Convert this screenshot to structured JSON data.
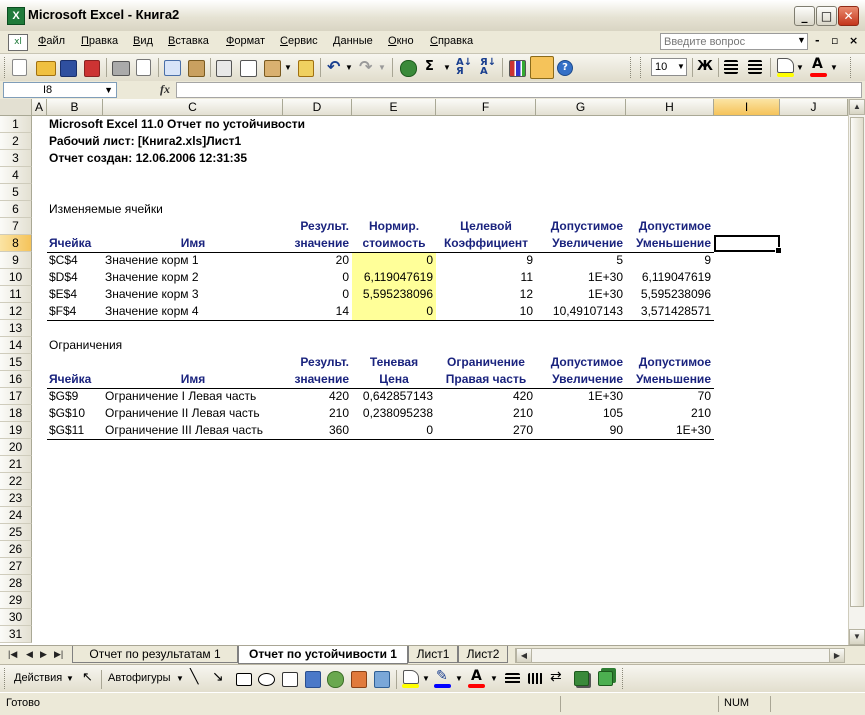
{
  "window": {
    "title": "Microsoft Excel - Книга2",
    "app_icon": "X",
    "controls": [
      "_",
      "□",
      "✕"
    ],
    "doc_icon": "xl",
    "mdi_controls": [
      "-",
      "▫",
      "×"
    ]
  },
  "menu": {
    "items": [
      {
        "label": "Файл",
        "u": "Ф",
        "rest": "айл"
      },
      {
        "label": "Правка",
        "u": "П",
        "rest": "равка"
      },
      {
        "label": "Вид",
        "u": "В",
        "rest": "ид"
      },
      {
        "label": "Вставка",
        "u": "В",
        "rest": "ставка"
      },
      {
        "label": "Формат",
        "u": "Ф",
        "rest": "ормат"
      },
      {
        "label": "Сервис",
        "u": "С",
        "rest": "ервис"
      },
      {
        "label": "Данные",
        "u": "Д",
        "rest": "анные"
      },
      {
        "label": "Окно",
        "u": "О",
        "rest": "кно"
      },
      {
        "label": "Справка",
        "u": "С",
        "rest": "правка"
      }
    ],
    "ask_placeholder": "Введите вопрос"
  },
  "toolbar": {
    "font_size": "10",
    "bold_label": "Ж",
    "sum_label": "Σ",
    "colors": {
      "fill": "#ffff00",
      "font": "#ff0000"
    }
  },
  "formula_bar": {
    "name_box": "I8",
    "fx_label": "fx",
    "value": ""
  },
  "columns": [
    "A",
    "B",
    "C",
    "D",
    "E",
    "F",
    "G",
    "H",
    "I",
    "J"
  ],
  "selected_column": "I",
  "rows": [
    "1",
    "2",
    "3",
    "4",
    "5",
    "6",
    "7",
    "8",
    "9",
    "10",
    "11",
    "12",
    "13",
    "14",
    "15",
    "16",
    "17",
    "18",
    "19",
    "20",
    "21",
    "22",
    "23",
    "24",
    "25",
    "26",
    "27",
    "28",
    "29",
    "30",
    "31"
  ],
  "selected_row": "8",
  "sheet": {
    "title1": "Microsoft Excel 11.0 Отчет по устойчивости",
    "title2": "Рабочий лист: [Книга2.xls]Лист1",
    "title3": "Отчет создан: 12.06.2006 12:31:35",
    "section1": "Изменяемые ячейки",
    "t1_headers_top": [
      "",
      "",
      "Результ.",
      "Нормир.",
      "Целевой",
      "Допустимое",
      "Допустимое"
    ],
    "t1_headers_bottom": [
      "Ячейка",
      "Имя",
      "значение",
      "стоимость",
      "Коэффициент",
      "Увеличение",
      "Уменьшение"
    ],
    "t1_rows": [
      [
        "$C$4",
        "Значение корм 1",
        "20",
        "0",
        "9",
        "5",
        "9"
      ],
      [
        "$D$4",
        "Значение корм 2",
        "0",
        "6,119047619",
        "11",
        "1E+30",
        "6,119047619"
      ],
      [
        "$E$4",
        "Значение корм 3",
        "0",
        "5,595238096",
        "12",
        "1E+30",
        "5,595238096"
      ],
      [
        "$F$4",
        "Значение корм 4",
        "14",
        "0",
        "10",
        "10,49107143",
        "3,571428571"
      ]
    ],
    "section2": "Ограничения",
    "t2_headers_top": [
      "",
      "",
      "Результ.",
      "Теневая",
      "Ограничение",
      "Допустимое",
      "Допустимое"
    ],
    "t2_headers_bottom": [
      "Ячейка",
      "Имя",
      "значение",
      "Цена",
      "Правая часть",
      "Увеличение",
      "Уменьшение"
    ],
    "t2_rows": [
      [
        "$G$9",
        "Ограничение I Левая часть",
        "420",
        "0,642857143",
        "420",
        "1E+30",
        "70"
      ],
      [
        "$G$10",
        "Ограничение II Левая часть",
        "210",
        "0,238095238",
        "210",
        "105",
        "210"
      ],
      [
        "$G$11",
        "Ограничение III Левая часть",
        "360",
        "0",
        "270",
        "90",
        "1E+30"
      ]
    ]
  },
  "tabs": {
    "items": [
      "Отчет по результатам 1",
      "Отчет по устойчивости 1",
      "Лист1",
      "Лист2"
    ],
    "active": 1
  },
  "drawing_toolbar": {
    "actions_label": "Действия",
    "autoshapes_label": "Автофигуры"
  },
  "status": {
    "ready": "Готово",
    "num": "NUM"
  }
}
